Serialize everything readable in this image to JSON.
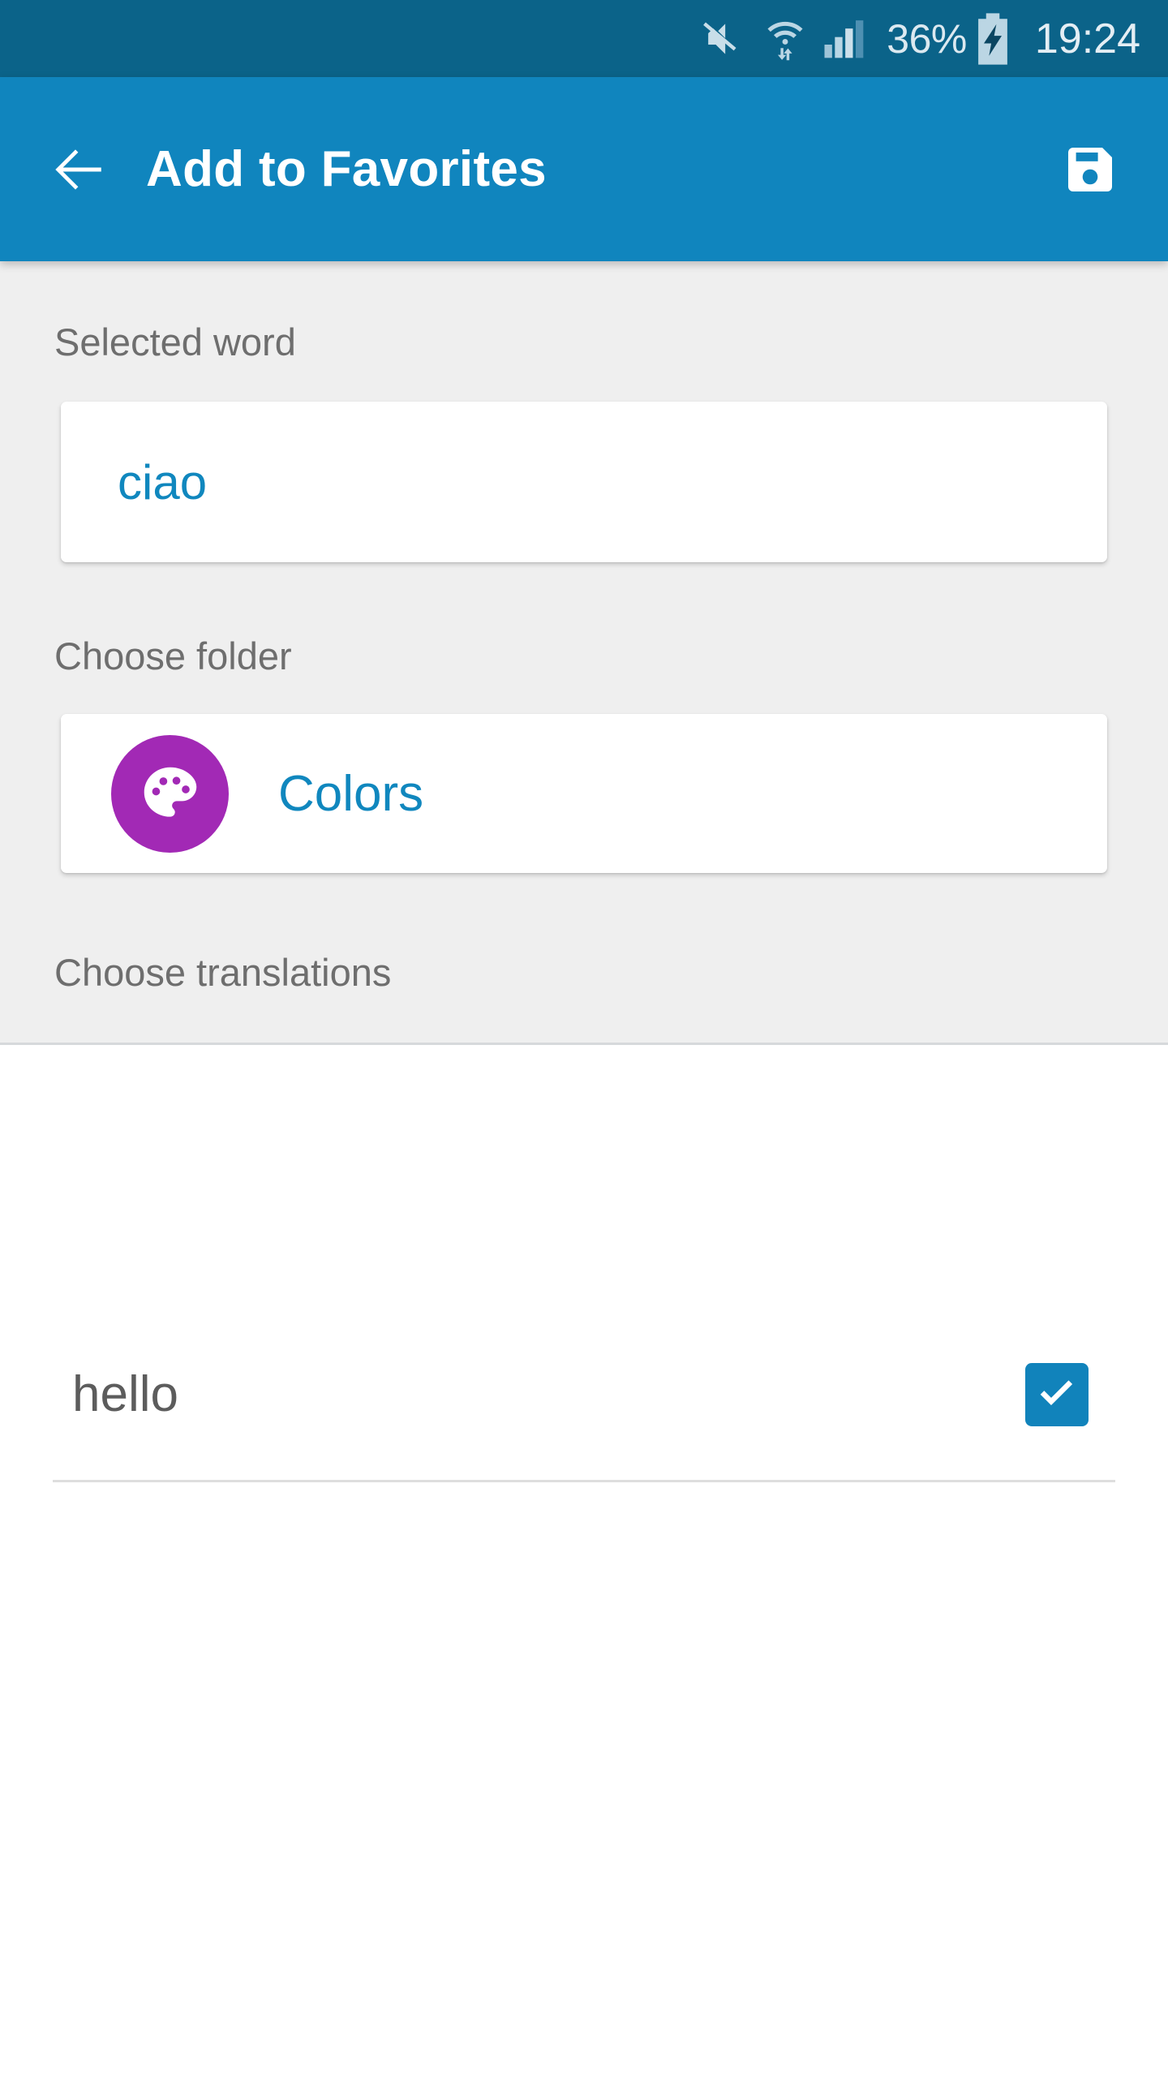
{
  "status_bar": {
    "background_color": "#0B6389",
    "battery_percent": "36%",
    "clock": "19:24",
    "icons": [
      {
        "name": "mute-icon",
        "label": "Sound muted"
      },
      {
        "name": "wifi-icon",
        "label": "Wi-Fi with data transfer"
      },
      {
        "name": "signal-icon",
        "label": "Cellular signal"
      },
      {
        "name": "battery-charging-icon",
        "label": "Battery charging"
      }
    ]
  },
  "app_bar": {
    "background_color": "#1085BE",
    "title": "Add to Favorites",
    "back_icon": "back-arrow-icon",
    "save_icon": "save-floppy-icon"
  },
  "content": {
    "background_color": "#EFEFEF",
    "accent_color": "#1087BE",
    "selected_word": {
      "label": "Selected word",
      "value": "ciao"
    },
    "choose_folder": {
      "label": "Choose folder",
      "folder_name": "Colors",
      "folder_icon": "palette-icon",
      "folder_color": "#A229B5"
    },
    "choose_translations": {
      "label": "Choose translations",
      "items": [
        {
          "text": "hello",
          "checked": true
        }
      ]
    }
  }
}
